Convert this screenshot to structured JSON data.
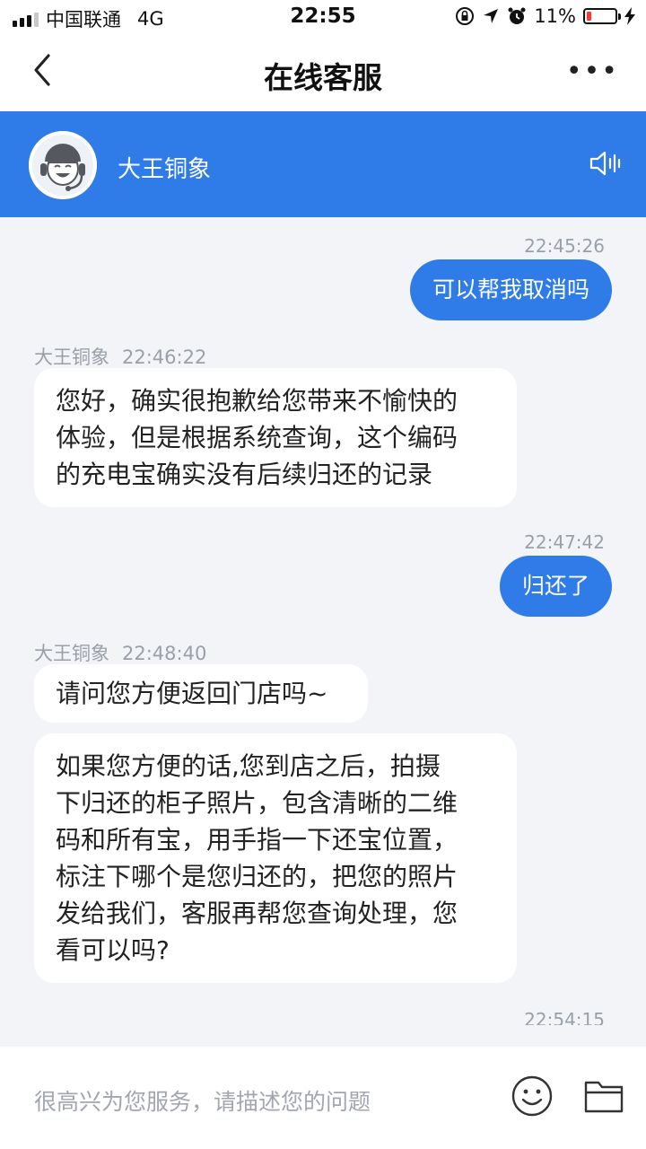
{
  "status_bar": {
    "carrier": "中国联通",
    "network": "4G",
    "time": "22:55",
    "battery": "11%",
    "battery_level": 0.11
  },
  "nav": {
    "title": "在线客服",
    "more_label": "•••"
  },
  "agent": {
    "name": "大王铜象"
  },
  "messages": [
    {
      "time": "22:45:26",
      "text": "可以帮我取消吗"
    },
    {
      "sender": "大王铜象",
      "time": "22:46:22",
      "lines": [
        "您好，确实很抱歉给您带来不愉快的",
        "体验，但是根据系统查询，这个编码",
        "的充电宝确实没有后续归还的记录"
      ]
    },
    {
      "time": "22:47:42",
      "text": "归还了"
    },
    {
      "sender": "大王铜象",
      "time": "22:48:40",
      "lines": [
        "请问您方便返回门店吗~"
      ]
    },
    {
      "lines": [
        "如果您方便的话,您到店之后，拍摄",
        "下归还的柜子照片，包含清晰的二维",
        "码和所有宝，用手指一下还宝位置，",
        "标注下哪个是您归还的，把您的照片",
        "发给我们，客服再帮您查询处理，您",
        "看可以吗?"
      ]
    },
    {
      "time": "22:54:15"
    }
  ],
  "input": {
    "placeholder": "很高兴为您服务，请描述您的问题"
  },
  "colors": {
    "accent": "#2f7ce8",
    "background": "#f2f4f8",
    "battery_low": "#ff3b30"
  },
  "icons": [
    "back-icon",
    "more-icon",
    "agent-avatar",
    "speaker-icon",
    "emoji-icon",
    "folder-icon"
  ]
}
